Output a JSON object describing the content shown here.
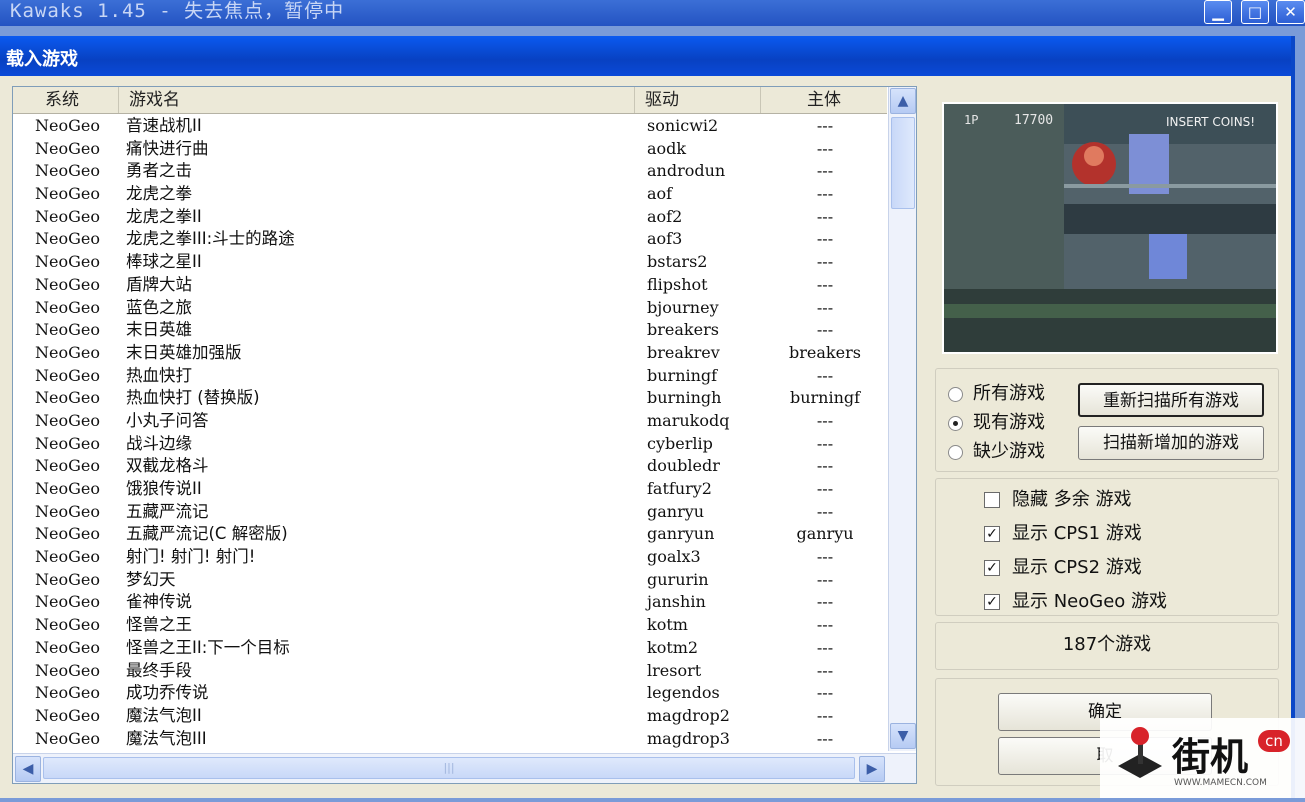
{
  "window": {
    "title": "Kawaks 1.45 - 失去焦点，暂停中"
  },
  "dialog": {
    "title": "载入游戏"
  },
  "list": {
    "headers": {
      "system": "系统",
      "name": "游戏名",
      "driver": "驱动",
      "parent": "主体"
    },
    "rows": [
      {
        "system": "NeoGeo",
        "name": "音速战机II",
        "driver": "sonicwi2",
        "parent": "---"
      },
      {
        "system": "NeoGeo",
        "name": "痛快进行曲",
        "driver": "aodk",
        "parent": "---"
      },
      {
        "system": "NeoGeo",
        "name": "勇者之击",
        "driver": "androdun",
        "parent": "---"
      },
      {
        "system": "NeoGeo",
        "name": "龙虎之拳",
        "driver": "aof",
        "parent": "---"
      },
      {
        "system": "NeoGeo",
        "name": "龙虎之拳II",
        "driver": "aof2",
        "parent": "---"
      },
      {
        "system": "NeoGeo",
        "name": "龙虎之拳III:斗士的路途",
        "driver": "aof3",
        "parent": "---"
      },
      {
        "system": "NeoGeo",
        "name": "棒球之星II",
        "driver": "bstars2",
        "parent": "---"
      },
      {
        "system": "NeoGeo",
        "name": "盾牌大站",
        "driver": "flipshot",
        "parent": "---"
      },
      {
        "system": "NeoGeo",
        "name": "蓝色之旅",
        "driver": "bjourney",
        "parent": "---"
      },
      {
        "system": "NeoGeo",
        "name": "末日英雄",
        "driver": "breakers",
        "parent": "---"
      },
      {
        "system": "NeoGeo",
        "name": "末日英雄加强版",
        "driver": "breakrev",
        "parent": "breakers"
      },
      {
        "system": "NeoGeo",
        "name": "热血快打",
        "driver": "burningf",
        "parent": "---"
      },
      {
        "system": "NeoGeo",
        "name": "热血快打 (替换版)",
        "driver": "burningh",
        "parent": "burningf"
      },
      {
        "system": "NeoGeo",
        "name": "小丸子问答",
        "driver": "marukodq",
        "parent": "---"
      },
      {
        "system": "NeoGeo",
        "name": "战斗边缘",
        "driver": "cyberlip",
        "parent": "---"
      },
      {
        "system": "NeoGeo",
        "name": "双截龙格斗",
        "driver": "doubledr",
        "parent": "---"
      },
      {
        "system": "NeoGeo",
        "name": "饿狼传说II",
        "driver": "fatfury2",
        "parent": "---"
      },
      {
        "system": "NeoGeo",
        "name": "五藏严流记",
        "driver": "ganryu",
        "parent": "---"
      },
      {
        "system": "NeoGeo",
        "name": "五藏严流记(C 解密版)",
        "driver": "ganryun",
        "parent": "ganryu"
      },
      {
        "system": "NeoGeo",
        "name": "射门! 射门! 射门!",
        "driver": "goalx3",
        "parent": "---"
      },
      {
        "system": "NeoGeo",
        "name": "梦幻天",
        "driver": "gururin",
        "parent": "---"
      },
      {
        "system": "NeoGeo",
        "name": "雀神传说",
        "driver": "janshin",
        "parent": "---"
      },
      {
        "system": "NeoGeo",
        "name": "怪兽之王",
        "driver": "kotm",
        "parent": "---"
      },
      {
        "system": "NeoGeo",
        "name": "怪兽之王II:下一个目标",
        "driver": "kotm2",
        "parent": "---"
      },
      {
        "system": "NeoGeo",
        "name": "最终手段",
        "driver": "lresort",
        "parent": "---"
      },
      {
        "system": "NeoGeo",
        "name": "成功乔传说",
        "driver": "legendos",
        "parent": "---"
      },
      {
        "system": "NeoGeo",
        "name": "魔法气泡II",
        "driver": "magdrop2",
        "parent": "---"
      },
      {
        "system": "NeoGeo",
        "name": "魔法气泡III",
        "driver": "magdrop3",
        "parent": "---"
      }
    ]
  },
  "preview": {
    "overlay_text": "INSERT COINS!",
    "score": "17700",
    "player": "1P"
  },
  "filter": {
    "all": "所有游戏",
    "available": "现有游戏",
    "missing": "缺少游戏",
    "selected": "available"
  },
  "buttons": {
    "rescan_all": "重新扫描所有游戏",
    "scan_new": "扫描新增加的游戏",
    "ok": "确定",
    "cancel": "取"
  },
  "options": {
    "hide_extra": "隐藏 多余 游戏",
    "show_cps1": "显示 CPS1 游戏",
    "show_cps2": "显示 CPS2 游戏",
    "show_neogeo": "显示 NeoGeo 游戏"
  },
  "status": {
    "count": "187个游戏"
  },
  "watermark": {
    "logo_text": "街机",
    "badge": "cn",
    "url": "WWW.MAMECN.COM"
  }
}
